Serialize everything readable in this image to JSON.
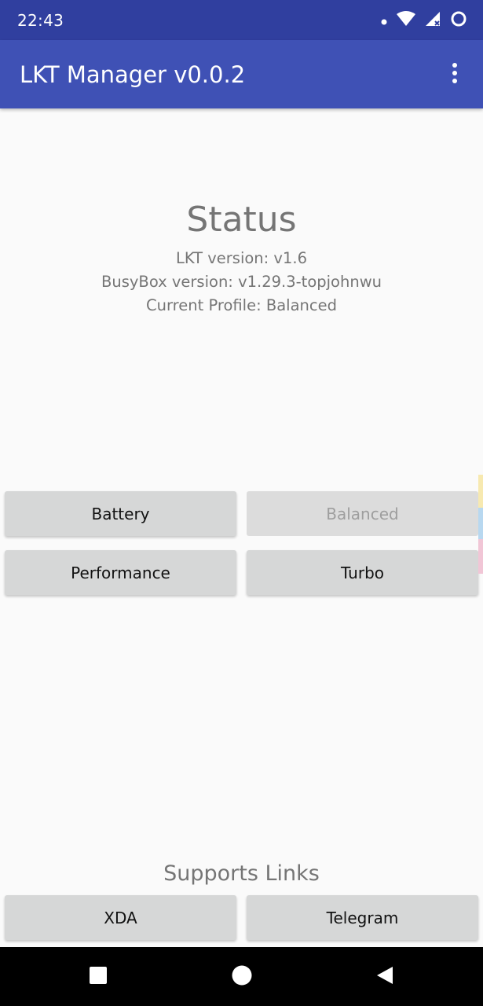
{
  "status_bar": {
    "time": "22:43",
    "icons": [
      "notification-dot-icon",
      "wifi-icon",
      "cellular-signal-icon",
      "battery-icon"
    ]
  },
  "app_bar": {
    "title": "LKT Manager v0.0.2",
    "menu_icon": "overflow-menu-icon"
  },
  "status": {
    "title": "Status",
    "lkt_version": "LKT version: v1.6",
    "busybox_version": "BusyBox version: v1.29.3-topjohnwu",
    "current_profile": "Current Profile: Balanced"
  },
  "profiles": {
    "battery": "Battery",
    "balanced": "Balanced",
    "performance": "Performance",
    "turbo": "Turbo",
    "selected": "Balanced"
  },
  "support": {
    "title": "Supports Links",
    "xda": "XDA",
    "telegram": "Telegram"
  },
  "nav_bar": {
    "icons": [
      "recents-icon",
      "home-icon",
      "back-icon"
    ]
  },
  "colors": {
    "status_bar": "#303f9f",
    "app_bar": "#3f51b5",
    "background": "#fafafa",
    "button": "#d6d7d7",
    "secondary_text": "#757575"
  }
}
